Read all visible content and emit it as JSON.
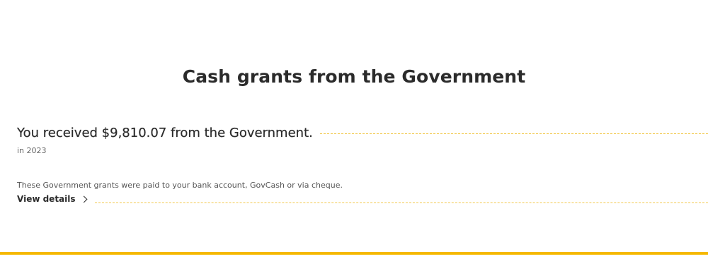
{
  "section": {
    "title": "Cash grants from the Government"
  },
  "summary": {
    "received_text": "You received $9,810.07 from the Government.",
    "year_text": "in 2023",
    "description": "These Government grants were paid to your bank account, GovCash or via cheque.",
    "details_label": "View details"
  },
  "colors": {
    "accent_bar": "#f5b800",
    "dashed_line": "#f2c94c",
    "text": "#2b2b2b"
  },
  "icons": {
    "details_chevron": "chevron-right-icon"
  }
}
